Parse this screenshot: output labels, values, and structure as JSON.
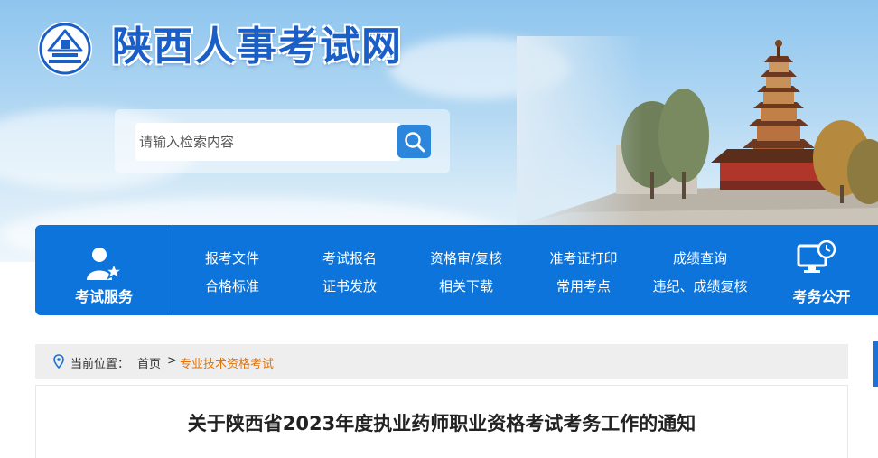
{
  "header": {
    "site_title": "陕西人事考试网",
    "logo_icon": "pagoda-logo-icon"
  },
  "search": {
    "placeholder": "请输入检索内容",
    "value": "",
    "button_icon": "search-icon"
  },
  "nav": {
    "left_label": "考试服务",
    "left_icon": "user-star-icon",
    "right_label": "考务公开",
    "right_icon": "monitor-clock-icon",
    "row1": [
      "报考文件",
      "考试报名",
      "资格审/复核",
      "准考证打印",
      "成绩查询"
    ],
    "row2": [
      "合格标准",
      "证书发放",
      "相关下载",
      "常用考点",
      "违纪、成绩复核"
    ]
  },
  "breadcrumb": {
    "prefix": "当前位置：",
    "home": "首页",
    "separator": ">",
    "current": "专业技术资格考试"
  },
  "article": {
    "title": "关于陕西省2023年度执业药师职业资格考试考务工作的通知"
  },
  "colors": {
    "nav_blue": "#0d74dc",
    "title_blue": "#1a5fc8",
    "breadcrumb_current": "#e2730a"
  }
}
